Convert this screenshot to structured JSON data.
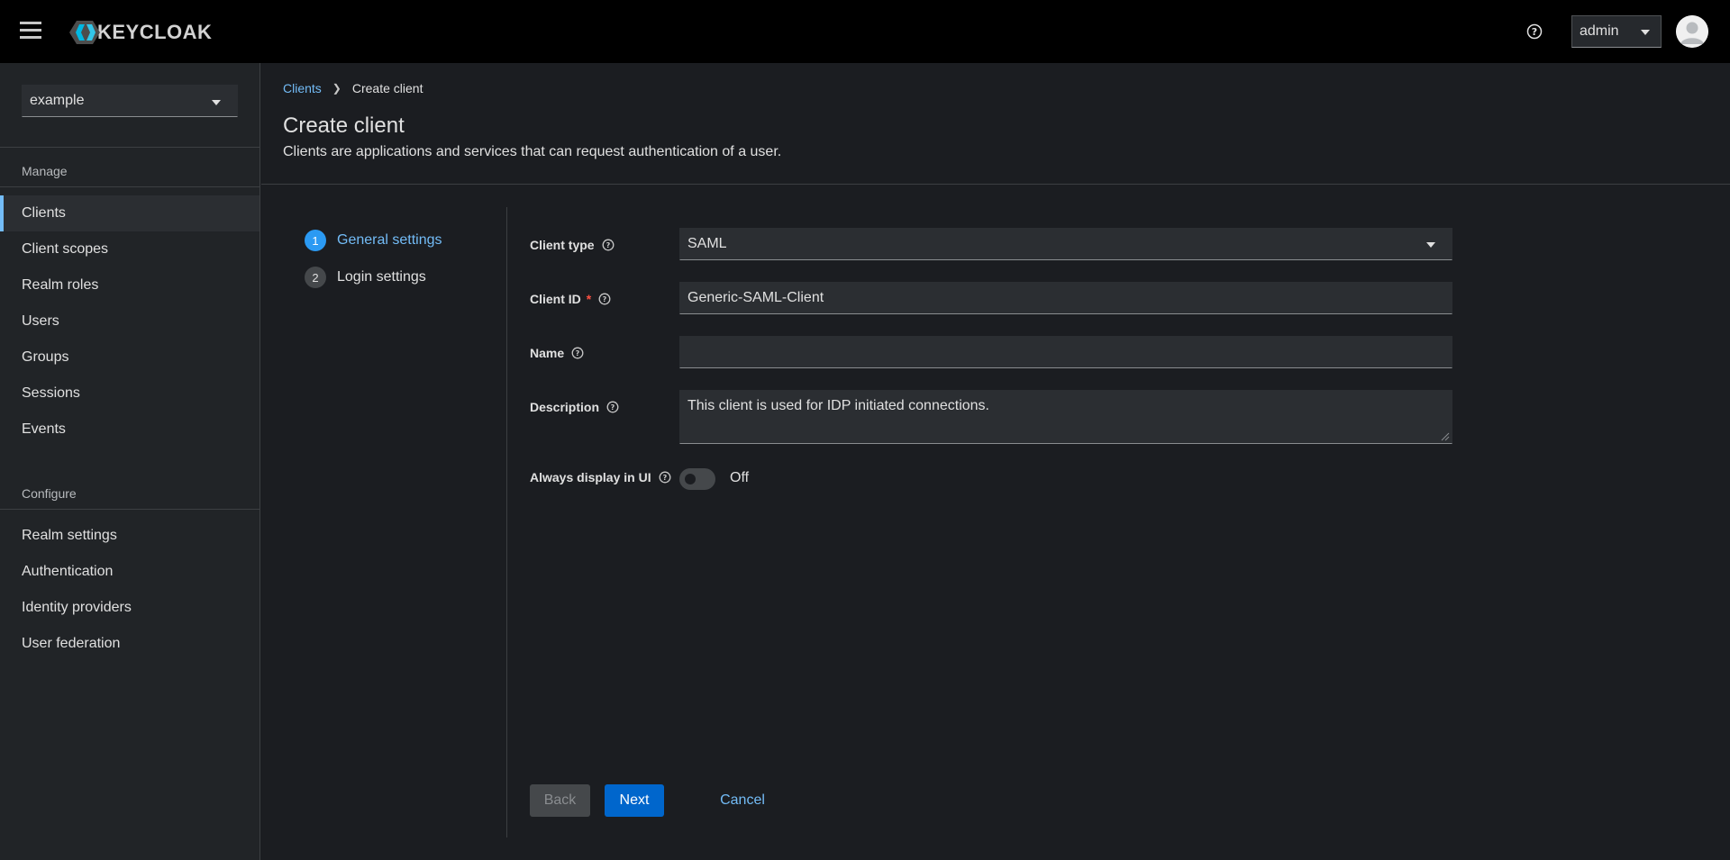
{
  "header": {
    "logo_text": "KEYCLOAK",
    "user": "admin"
  },
  "sidebar": {
    "realm": "example",
    "manage_title": "Manage",
    "manage_items": [
      "Clients",
      "Client scopes",
      "Realm roles",
      "Users",
      "Groups",
      "Sessions",
      "Events"
    ],
    "configure_title": "Configure",
    "configure_items": [
      "Realm settings",
      "Authentication",
      "Identity providers",
      "User federation"
    ]
  },
  "breadcrumb": {
    "parent": "Clients",
    "current": "Create client"
  },
  "page": {
    "title": "Create client",
    "subtitle": "Clients are applications and services that can request authentication of a user."
  },
  "wizard": {
    "steps": [
      {
        "num": "1",
        "label": "General settings"
      },
      {
        "num": "2",
        "label": "Login settings"
      }
    ]
  },
  "form": {
    "client_type_label": "Client type",
    "client_type_value": "SAML",
    "client_id_label": "Client ID",
    "client_id_required": "*",
    "client_id_value": "Generic-SAML-Client",
    "name_label": "Name",
    "name_value": "",
    "description_label": "Description",
    "description_value": "This client is used for IDP initiated connections.",
    "always_display_label": "Always display in UI",
    "always_display_state": "Off"
  },
  "buttons": {
    "back": "Back",
    "next": "Next",
    "cancel": "Cancel"
  },
  "colors": {
    "accent": "#73bcf7",
    "primary_button": "#0066cc",
    "required": "#fe5142"
  }
}
